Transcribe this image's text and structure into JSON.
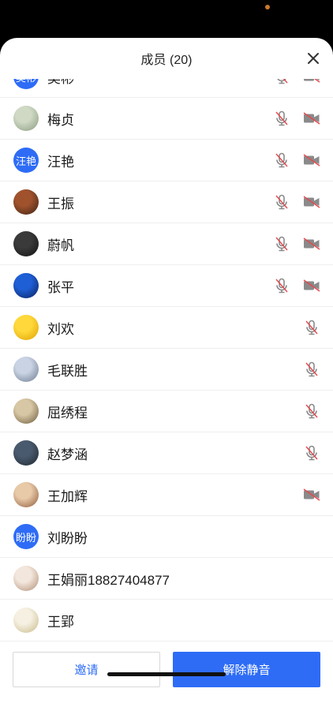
{
  "header": {
    "title": "成员 (20)"
  },
  "members": [
    {
      "name": "吴彬",
      "avatar_text": "吴彬",
      "avatar_type": "text",
      "mic_muted": true,
      "cam_muted": true
    },
    {
      "name": "梅贞",
      "avatar_type": "photo",
      "avatar_colors": [
        "#cfd9c4",
        "#8a9a7e"
      ],
      "mic_muted": true,
      "cam_muted": true
    },
    {
      "name": "汪艳",
      "avatar_text": "汪艳",
      "avatar_type": "text",
      "mic_muted": true,
      "cam_muted": true
    },
    {
      "name": "王振",
      "avatar_type": "photo",
      "avatar_colors": [
        "#a0522d",
        "#3b2314"
      ],
      "mic_muted": true,
      "cam_muted": true
    },
    {
      "name": "蔚帆",
      "avatar_type": "photo",
      "avatar_colors": [
        "#3a3a3a",
        "#111111"
      ],
      "mic_muted": true,
      "cam_muted": true
    },
    {
      "name": "张平",
      "avatar_type": "photo",
      "avatar_colors": [
        "#1f5fd6",
        "#0a1f5a"
      ],
      "mic_muted": true,
      "cam_muted": true
    },
    {
      "name": "刘欢",
      "avatar_type": "photo",
      "avatar_colors": [
        "#ffd93b",
        "#e0a100"
      ],
      "mic_muted": true,
      "cam_muted": false
    },
    {
      "name": "毛联胜",
      "avatar_type": "photo",
      "avatar_colors": [
        "#c9d3e3",
        "#6b7a8f"
      ],
      "mic_muted": true,
      "cam_muted": false
    },
    {
      "name": "屈绣程",
      "avatar_type": "photo",
      "avatar_colors": [
        "#d8c7a4",
        "#6b5a3c"
      ],
      "mic_muted": true,
      "cam_muted": false
    },
    {
      "name": "赵梦涵",
      "avatar_type": "photo",
      "avatar_colors": [
        "#4a5a6e",
        "#1d2630"
      ],
      "mic_muted": true,
      "cam_muted": false
    },
    {
      "name": "王加辉",
      "avatar_type": "photo",
      "avatar_colors": [
        "#e8c9a8",
        "#8c5a3a"
      ],
      "mic_muted": false,
      "cam_muted": true
    },
    {
      "name": "刘盼盼",
      "avatar_text": "盼盼",
      "avatar_type": "text",
      "mic_muted": false,
      "cam_muted": false
    },
    {
      "name": "王娟丽18827404877",
      "avatar_type": "photo",
      "avatar_colors": [
        "#f3e6dc",
        "#b08c74"
      ],
      "mic_muted": false,
      "cam_muted": false
    },
    {
      "name": "王郢",
      "avatar_type": "photo",
      "avatar_colors": [
        "#f5f0e1",
        "#c9b98a"
      ],
      "mic_muted": false,
      "cam_muted": false
    }
  ],
  "footer": {
    "invite_label": "邀请",
    "unmute_all_label": "解除静音"
  },
  "colors": {
    "accent": "#2e6cf6",
    "muted_slash": "#e5484d",
    "icon_gray": "#8a8a8a"
  }
}
